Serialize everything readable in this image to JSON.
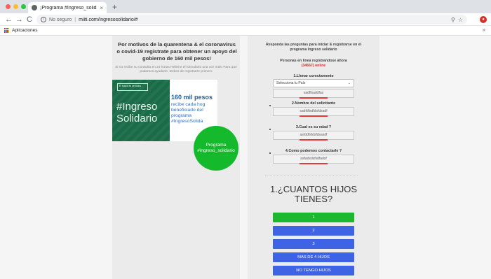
{
  "browser": {
    "tab_title": "¡Programa #Ingreso_solidario!",
    "tab_close": "×",
    "new_tab": "+",
    "back": "←",
    "forward": "→",
    "reload": "C",
    "insecure_label": "No seguro",
    "url": "miiti.com/ingresosolidario/#",
    "bookmarks_label": "Aplicaciones",
    "bookmarks_more": "»"
  },
  "left": {
    "headline": "Por motivos de la quarentena & el coronavirus o covid-19 registrate para obtener un apoyo del gobierno de 160 mil pesos!",
    "note": "Si no recibe su consulta en 24 horas Rellene el formulario una vez más! Para que podamos ayudarle. Debes de registrarte primero",
    "banner": {
      "logo_text": "El futuro es de todos",
      "hashtag": "#Ingreso Solidario",
      "amount": "160 mil pesos",
      "subtitle": "recibe cada hog beneficiado del programa #IngresoSolida"
    },
    "cta": "Programa #ingreso_solidario"
  },
  "form": {
    "title": "Responda las preguntas para iniciar & registrarse en el programa Ingreso solidario",
    "online_label": "Personas en linea registrandose ahora",
    "online_count": "(34667) online",
    "q1_label": "1.Llenar corectamente",
    "q1_select": "Selecciona tu País",
    "q1_value": "sadffsaddfas",
    "q2_label": "2.Nombre del solicitante",
    "q2_value": "sadfdfsdfdsfdsadf",
    "q3_label": "3.Cual es su edad ?",
    "q3_value": "asfddfsfdsfdsasdf",
    "q4_label": "4.Como podemos contactarle ?",
    "q4_value": "asfadsdsfsdfadsf",
    "question": "1.¿CUANTOS HIJOS TIENES?",
    "answers": [
      "1",
      "2",
      "3",
      "MAS DE 4 HIJOS",
      "NO TENGO HIJOS"
    ]
  },
  "colors": {
    "accent_green": "#1cb82f",
    "button_blue": "#3f63e5",
    "alert_red": "#d32f2f"
  }
}
